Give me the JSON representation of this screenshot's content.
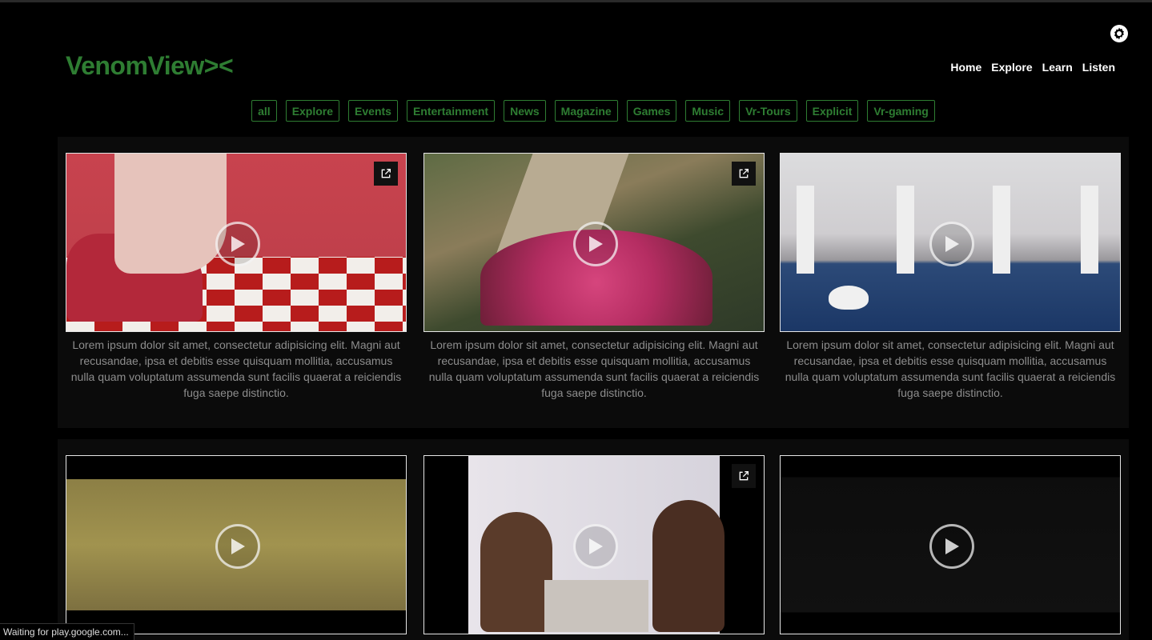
{
  "app": {
    "logo": "VenomView><"
  },
  "nav": {
    "items": [
      "Home",
      "Explore",
      "Learn",
      "Listen"
    ]
  },
  "categories": [
    "all",
    "Explore",
    "Events",
    "Entertainment",
    "News",
    "Magazine",
    "Games",
    "Music",
    "Vr-Tours",
    "Explicit",
    "Vr-gaming"
  ],
  "videos": [
    {
      "description": "Lorem ipsum dolor sit amet, consectetur adipisicing elit. Magni aut recusandae, ipsa et debitis esse quisquam mollitia, accusamus nulla quam voluptatum assumenda sunt facilis quaerat a reiciendis fuga saepe distinctio.",
      "thumbnail": "pink-room-checkered-floor"
    },
    {
      "description": "Lorem ipsum dolor sit amet, consectetur adipisicing elit. Magni aut recusandae, ipsa et debitis esse quisquam mollitia, accusamus nulla quam voluptatum assumenda sunt facilis quaerat a reiciendis fuga saepe distinctio.",
      "thumbnail": "flowers-desert-road"
    },
    {
      "description": "Lorem ipsum dolor sit amet, consectetur adipisicing elit. Magni aut recusandae, ipsa et debitis esse quisquam mollitia, accusamus nulla quam voluptatum assumenda sunt facilis quaerat a reiciendis fuga saepe distinctio.",
      "thumbnail": "indoor-pool-swans"
    },
    {
      "thumbnail": "golden-texture"
    },
    {
      "thumbnail": "two-people-paint-cans"
    },
    {
      "thumbnail": "dark-frame"
    }
  ],
  "status": {
    "text": "Waiting for play.google.com..."
  },
  "colors": {
    "accent": "#2e7d32",
    "background": "#000000",
    "panel": "#0b0b0b"
  },
  "icons": {
    "settings": "gear-icon",
    "play": "play-icon",
    "external": "external-link-icon"
  }
}
